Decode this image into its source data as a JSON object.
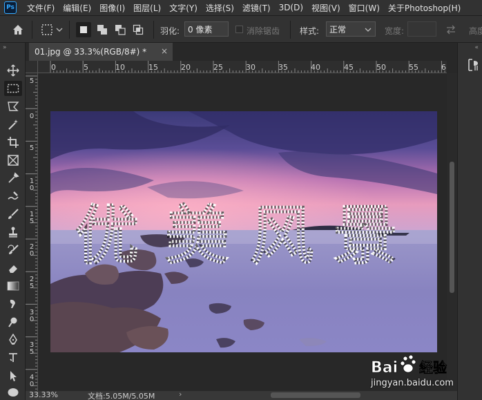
{
  "menu": {
    "logo": "Ps",
    "items": [
      "文件(F)",
      "编辑(E)",
      "图像(I)",
      "图层(L)",
      "文字(Y)",
      "选择(S)",
      "滤镜(T)",
      "3D(D)",
      "视图(V)",
      "窗口(W)",
      "关于Photoshop(H)"
    ]
  },
  "options": {
    "feather_label": "羽化:",
    "feather_value": "0 像素",
    "antialias_label": "消除锯齿",
    "style_label": "样式:",
    "style_value": "正常",
    "width_label": "宽度:",
    "height_label": "高度"
  },
  "tab": {
    "title": "01.jpg @ 33.3%(RGB/8#) *",
    "close": "×"
  },
  "ruler": {
    "h_labels": [
      "0",
      "5",
      "10",
      "15",
      "20",
      "25",
      "30",
      "35",
      "40",
      "45",
      "50",
      "55",
      "6"
    ],
    "v_labels": [
      "5",
      "0",
      "5",
      "1\n0",
      "1\n5",
      "2\n0",
      "2\n5",
      "3\n0",
      "3\n5",
      "4\n0"
    ]
  },
  "status": {
    "zoom": "33.33%",
    "doc": "文档:5.05M/5.05M",
    "arrow": "›"
  },
  "selection_text": "优美风景",
  "watermark": {
    "brand": "Bai",
    "brand2": "经验",
    "site": "jingyan.baidu.com"
  },
  "colors": {
    "ui_dark": "#282828",
    "panel": "#323232",
    "accent_ps": "#31a8ff"
  }
}
